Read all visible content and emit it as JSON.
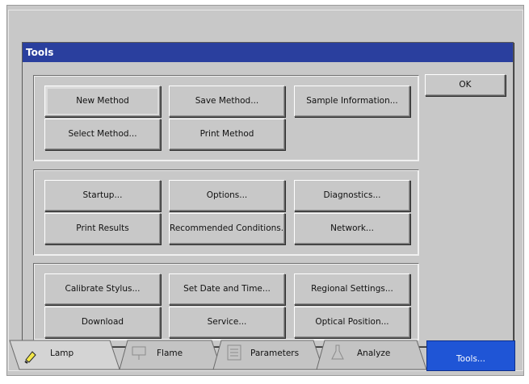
{
  "dialog": {
    "title": "Tools",
    "ok_label": "OK"
  },
  "groups": [
    {
      "buttons": [
        "New Method",
        "Save Method...",
        "Sample Information...",
        "Select Method...",
        "Print Method"
      ]
    },
    {
      "buttons": [
        "Startup...",
        "Options...",
        "Diagnostics...",
        "Print Results",
        "Recommended Conditions...",
        "Network..."
      ]
    },
    {
      "buttons": [
        "Calibrate Stylus...",
        "Set Date and Time...",
        "Regional Settings...",
        "Download",
        "Service...",
        "Optical Position..."
      ]
    }
  ],
  "tabs": [
    {
      "label": "Lamp",
      "icon": "lamp-icon"
    },
    {
      "label": "Flame",
      "icon": "flame-icon"
    },
    {
      "label": "Parameters",
      "icon": "parameters-icon"
    },
    {
      "label": "Analyze",
      "icon": "analyze-icon"
    },
    {
      "label": "Tools...",
      "selected": true
    }
  ],
  "colors": {
    "titlebar": "#2a3f9e",
    "background": "#c8c8c8",
    "selected_tab": "#1f55d6"
  }
}
